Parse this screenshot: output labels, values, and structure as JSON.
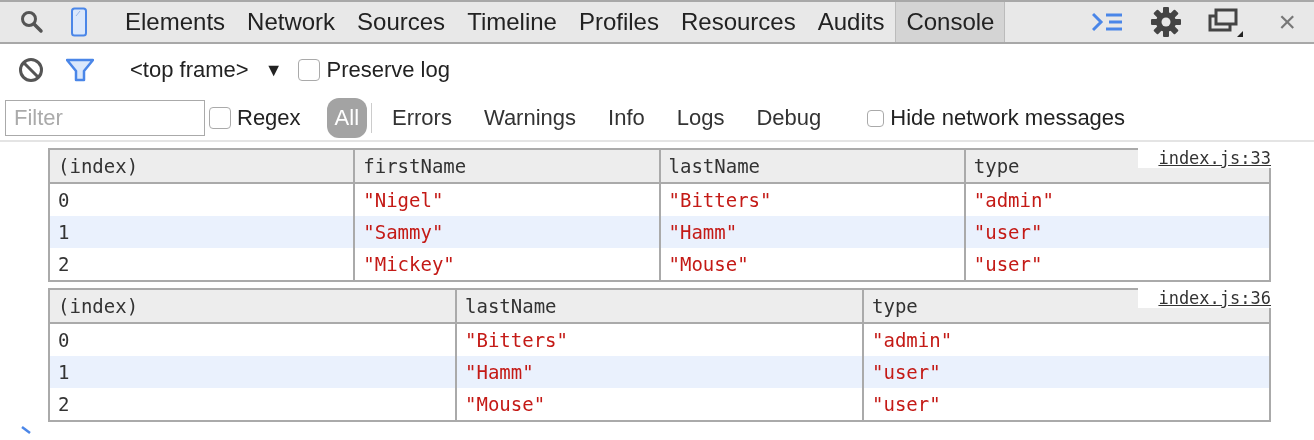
{
  "tabs": [
    {
      "label": "Elements",
      "selected": false
    },
    {
      "label": "Network",
      "selected": false
    },
    {
      "label": "Sources",
      "selected": false
    },
    {
      "label": "Timeline",
      "selected": false
    },
    {
      "label": "Profiles",
      "selected": false
    },
    {
      "label": "Resources",
      "selected": false
    },
    {
      "label": "Audits",
      "selected": false
    },
    {
      "label": "Console",
      "selected": true
    }
  ],
  "close": "×",
  "toolbar": {
    "frame": "<top frame>",
    "frame_caret": "▼",
    "preserve_log": {
      "label": "Preserve log",
      "checked": false
    }
  },
  "filter_bar": {
    "placeholder": "Filter",
    "regex": {
      "label": "Regex",
      "checked": false
    },
    "levels": [
      {
        "label": "All",
        "selected": true
      },
      {
        "label": "Errors",
        "selected": false
      },
      {
        "label": "Warnings",
        "selected": false
      },
      {
        "label": "Info",
        "selected": false
      },
      {
        "label": "Logs",
        "selected": false
      },
      {
        "label": "Debug",
        "selected": false
      }
    ],
    "hide_network": {
      "label": "Hide network messages",
      "checked": false
    }
  },
  "messages": [
    {
      "source": "index.js:33",
      "columns": [
        "(index)",
        "firstName",
        "lastName",
        "type"
      ],
      "rows": [
        [
          "0",
          "\"Nigel\"",
          "\"Bitters\"",
          "\"admin\""
        ],
        [
          "1",
          "\"Sammy\"",
          "\"Hamm\"",
          "\"user\""
        ],
        [
          "2",
          "\"Mickey\"",
          "\"Mouse\"",
          "\"user\""
        ]
      ]
    },
    {
      "source": "index.js:36",
      "columns": [
        "(index)",
        "lastName",
        "type"
      ],
      "rows": [
        [
          "0",
          "\"Bitters\"",
          "\"admin\""
        ],
        [
          "1",
          "\"Hamm\"",
          "\"user\""
        ],
        [
          "2",
          "\"Mouse\"",
          "\"user\""
        ]
      ]
    }
  ]
}
